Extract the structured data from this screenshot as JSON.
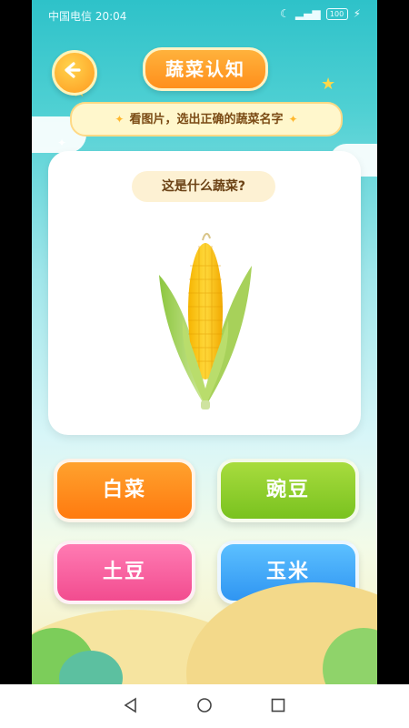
{
  "status": {
    "carrier_time": "中国电信 20:04",
    "battery": "100"
  },
  "header": {
    "title": "蔬菜认知",
    "instruction": "看图片，选出正确的蔬菜名字"
  },
  "card": {
    "question": "这是什么蔬菜?"
  },
  "options": [
    "白菜",
    "豌豆",
    "土豆",
    "玉米"
  ],
  "icons": {
    "back": "arrow-left-icon",
    "image": "corn-illustration",
    "nav_back": "triangle-back-icon",
    "nav_home": "circle-home-icon",
    "nav_recent": "square-recent-icon"
  },
  "colors": {
    "orange": "#ff8f1c",
    "green": "#79c21f",
    "pink": "#f24c8f",
    "blue": "#2f95f2",
    "teal": "#2ec2c9"
  }
}
